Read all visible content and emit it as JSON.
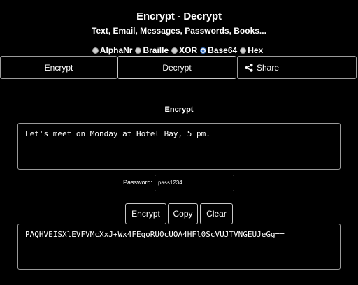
{
  "header": {
    "title": "Encrypt - Decrypt",
    "subtitle": "Text, Email, Messages, Passwords, Books..."
  },
  "modes": {
    "options": [
      "AlphaNr",
      "Braille",
      "XOR",
      "Base64",
      "Hex"
    ],
    "selected": "Base64"
  },
  "tabs": {
    "encrypt": "Encrypt",
    "decrypt": "Decrypt",
    "share": "Share",
    "share_icon": "share-icon"
  },
  "main": {
    "section_label": "Encrypt",
    "input_text": "Let's meet on Monday at Hotel Bay, 5 pm.",
    "password_label": "Password:",
    "password_value": "pass1234",
    "output_text": "PAQHVEISXlEVFVMcXxJ+Wx4FEgoRU0cUOA4HFl0ScVUJTVNGEUJeGg=="
  },
  "buttons": {
    "encrypt": "Encrypt",
    "copy": "Copy",
    "clear": "Clear"
  },
  "colors": {
    "background": "#000000",
    "text": "#ffffff",
    "border": "#9a9a9a",
    "radio_selected": "#3b76c8"
  }
}
